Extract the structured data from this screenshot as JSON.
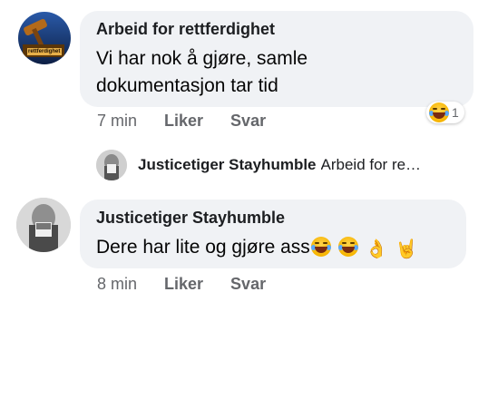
{
  "comments": [
    {
      "author": "Arbeid for rettferdighet",
      "avatar_label": "rettferdighet",
      "text_line1": "Vi har nok å gjøre, samle",
      "text_line2": "dokumentasjon tar tid",
      "time": "7 min",
      "like_label": "Liker",
      "reply_label": "Svar",
      "reaction": {
        "icon": "laughing-emoji-icon",
        "count": "1"
      }
    },
    {
      "author": "Justicetiger Stayhumble",
      "text": "Dere har lite og gjøre ass",
      "emojis": [
        "laughing-emoji-icon",
        "laughing-emoji-icon",
        "ok-hand-icon",
        "rock-hand-icon"
      ],
      "time": "8 min",
      "like_label": "Liker",
      "reply_label": "Svar"
    }
  ],
  "reply_preview": {
    "author": "Justicetiger Stayhumble",
    "text": "Arbeid for re…"
  }
}
